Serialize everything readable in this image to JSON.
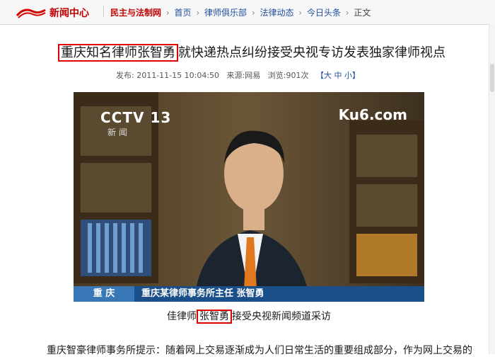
{
  "header": {
    "brand": "新闻中心",
    "site": "民主与法制网",
    "crumbs": [
      "首页",
      "律师俱乐部",
      "法律动态",
      "今日头条",
      "正文"
    ]
  },
  "article": {
    "headline_highlight": "重庆知名律师张智勇",
    "headline_rest": "就快递热点纠纷接受央视专访发表独家律师视点",
    "meta": {
      "published_label": "发布:",
      "published": "2011-11-15 10:04:50",
      "source_label": "来源:",
      "source": "网易",
      "views_label": "浏览:",
      "views": "901次",
      "size_label": "【大 中 小】"
    },
    "photo": {
      "channel_logo": "CCTV 13",
      "channel_sub": "新 闻",
      "watermark": "Ku6.com",
      "lower_third_location": "重 庆",
      "lower_third_text": "重庆某律师事务所主任 张智勇"
    },
    "caption_prefix": "佳律师",
    "caption_highlight": "张智勇",
    "caption_suffix": "接受央视新闻频道采访",
    "body_first_line": "重庆智豪律师事务所提示：随着网上交易逐渐成为人们日常生活的重要组成部分，作为网上交易的"
  },
  "colors": {
    "brand_red": "#c40000",
    "highlight_box": "#e00000",
    "link_blue": "#1f4e9e"
  }
}
